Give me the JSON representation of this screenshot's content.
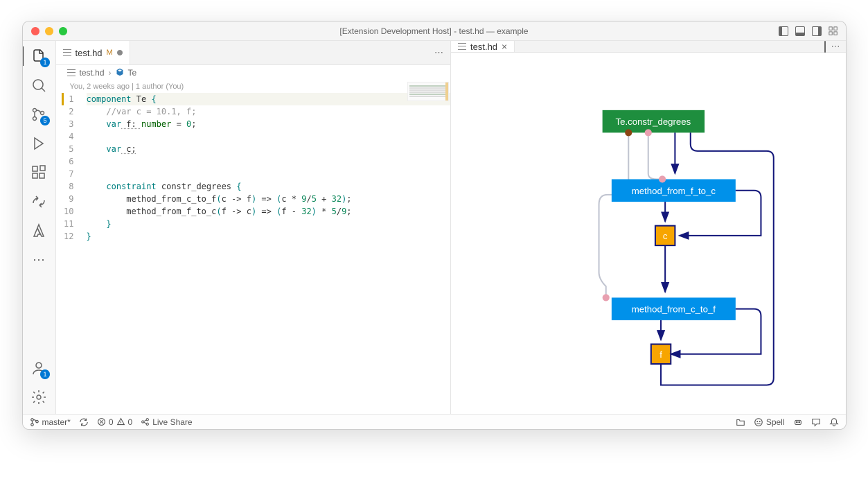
{
  "window": {
    "title": "[Extension Development Host] - test.hd — example"
  },
  "activitybar": {
    "explorer_badge": "1",
    "scm_badge": "5",
    "accounts_badge": "1"
  },
  "editor_left": {
    "tab": {
      "filename": "test.hd",
      "modified_marker": "M"
    },
    "tabs_more": "⋯",
    "breadcrumb": {
      "file": "test.hd",
      "symbol": "Te"
    },
    "annotation": "You, 2 weeks ago | 1 author (You)",
    "lines": [
      "1",
      "2",
      "3",
      "4",
      "5",
      "6",
      "7",
      "8",
      "9",
      "10",
      "11",
      "12"
    ],
    "code": {
      "l1_kw": "component",
      "l1_name": " Te ",
      "l1_brace": "{",
      "l2": "    //var c = 10.1, f;",
      "l3_kw": "    var",
      "l3_name": " f: ",
      "l3_type": "number",
      "l3_rest": " = ",
      "l3_num": "0",
      "l3_semi": ";",
      "l4": "",
      "l5_kw": "    var",
      "l5_name": " c;",
      "l6": "",
      "l7": "",
      "l8_kw": "    constraint",
      "l8_name": " constr_degrees ",
      "l8_brace": "{",
      "l9_a": "        method_from_c_to_f",
      "l9_p1": "(",
      "l9_b": "c -> f",
      "l9_p2": ")",
      "l9_c": " => ",
      "l9_p3": "(",
      "l9_d": "c * ",
      "l9_n1": "9",
      "l9_e": "/",
      "l9_n2": "5",
      "l9_f": " + ",
      "l9_n3": "32",
      "l9_p4": ")",
      "l9_semi": ";",
      "l10_a": "        method_from_f_to_c",
      "l10_p1": "(",
      "l10_b": "f -> c",
      "l10_p2": ")",
      "l10_c": " => ",
      "l10_p3": "(",
      "l10_d": "f - ",
      "l10_n1": "32",
      "l10_p4": ")",
      "l10_e": " * ",
      "l10_n2": "5",
      "l10_f": "/",
      "l10_n3": "9",
      "l10_semi": ";",
      "l11": "    }",
      "l12": "}"
    }
  },
  "editor_right": {
    "tab": {
      "filename": "test.hd"
    },
    "tabs_more": "⋯",
    "diagram": {
      "root": "Te.constr_degrees",
      "method1": "method_from_f_to_c",
      "var_c": "c",
      "method2": "method_from_c_to_f",
      "var_f": "f"
    }
  },
  "statusbar": {
    "branch": "master*",
    "errors": "0",
    "warnings": "0",
    "liveshare": "Live Share",
    "spell": "Spell"
  }
}
